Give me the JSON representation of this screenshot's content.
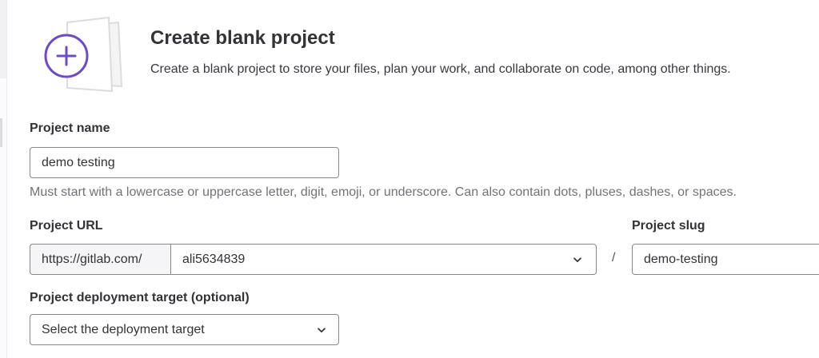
{
  "header": {
    "title": "Create blank project",
    "description": "Create a blank project to store your files, plan your work, and collaborate on code, among other things."
  },
  "project_name": {
    "label": "Project name",
    "value": "demo testing",
    "help": "Must start with a lowercase or uppercase letter, digit, emoji, or underscore. Can also contain dots, pluses, dashes, or spaces."
  },
  "project_url": {
    "label": "Project URL",
    "prefix": "https://gitlab.com/",
    "namespace": "ali5634839",
    "separator": "/"
  },
  "project_slug": {
    "label": "Project slug",
    "value": "demo-testing"
  },
  "deployment_target": {
    "label": "Project deployment target (optional)",
    "selected": "Select the deployment target"
  },
  "colors": {
    "accent": "#6e49cb",
    "text": "#333238",
    "help_text": "#737278",
    "border": "#89888d"
  },
  "icons": {
    "illustration": "plus-circle-icon",
    "dropdown": "chevron-down-icon"
  }
}
